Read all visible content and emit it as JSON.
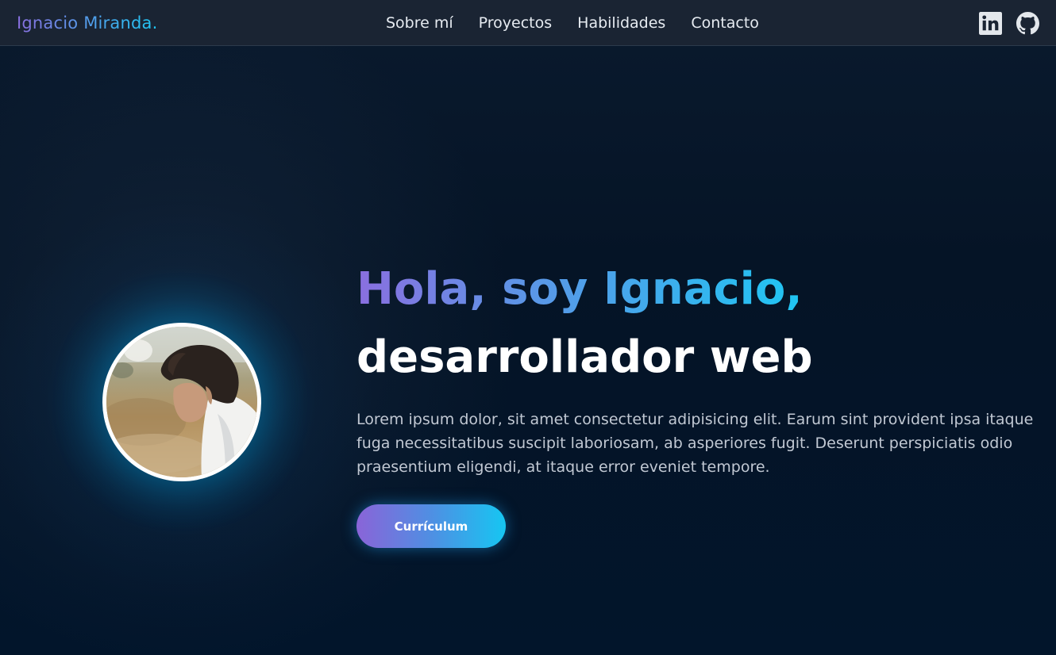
{
  "header": {
    "brand": "Ignacio Miranda.",
    "nav": [
      {
        "label": "Sobre mí"
      },
      {
        "label": "Proyectos"
      },
      {
        "label": "Habilidades"
      },
      {
        "label": "Contacto"
      }
    ],
    "social": [
      {
        "icon": "linkedin-icon"
      },
      {
        "icon": "github-icon"
      }
    ]
  },
  "hero": {
    "greeting": "Hola, soy Ignacio,",
    "role": "desarrollador web",
    "description": "Lorem ipsum dolor, sit amet consectetur adipisicing elit. Earum sint provident ipsa itaque fuga necessitatibus suscipit laboriosam, ab asperiores fugit. Deserunt perspiciatis odio praesentium eligendi, at itaque error eveniet tempore.",
    "button_label": "Currículum"
  },
  "colors": {
    "gradient_start": "#8a6fe0",
    "gradient_end": "#1ec8f4",
    "background": "#03152a",
    "navbar": "#1a2433"
  }
}
